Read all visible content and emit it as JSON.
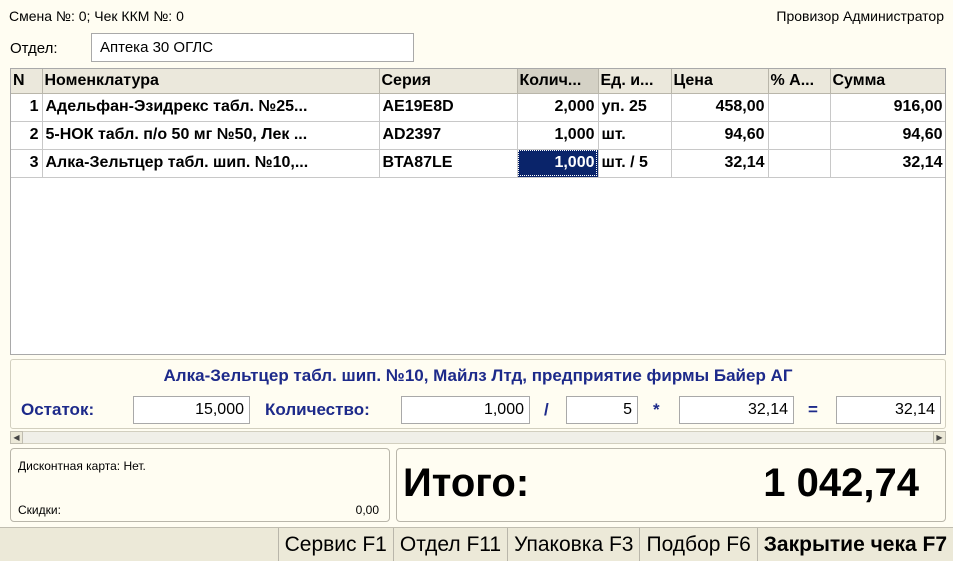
{
  "header": {
    "shift_info": "Смена №: 0; Чек ККМ №: 0",
    "user": "Провизор Администратор"
  },
  "department": {
    "label": "Отдел:",
    "value": "Аптека 30 ОГЛС"
  },
  "grid": {
    "columns": [
      "N",
      "Номенклатура",
      "Серия",
      "Колич...",
      "Ед. и...",
      "Цена",
      "% А...",
      "Сумма"
    ],
    "rows": [
      [
        "1",
        "Адельфан-Эзидрекс табл. №25...",
        "AE19E8D",
        "2,000",
        "уп. 25",
        "458,00",
        "",
        "916,00"
      ],
      [
        "2",
        "5-НОК табл. п/о 50 мг №50, Лек ...",
        "AD2397",
        "1,000",
        "шт.",
        "94,60",
        "",
        "94,60"
      ],
      [
        "3",
        "Алка-Зельтцер табл. шип. №10,...",
        "BTA87LE",
        "1,000",
        "шт. / 5",
        "32,14",
        "",
        "32,14"
      ]
    ]
  },
  "info": {
    "product_name": "Алка-Зельтцер табл. шип. №10, Майлз Лтд, предприятие фирмы Байер АГ",
    "stock_label": "Остаток:",
    "stock_value": "15,000",
    "qty_label": "Количество:",
    "qty_value": "1,000",
    "div_sign": "/",
    "pack_value": "5",
    "mul_sign": "*",
    "price_value": "32,14",
    "eq_sign": "=",
    "sum_value": "32,14"
  },
  "discount": {
    "card": "Дисконтная карта: Нет.",
    "label": "Скидки:",
    "value": "0,00"
  },
  "total": {
    "label": "Итого:",
    "value": "1 042,74"
  },
  "toolbar": {
    "service": "Сервис F1",
    "department": "Отдел F11",
    "package": "Упаковка F3",
    "selection": "Подбор F6",
    "close_check": "Закрытие чека F7"
  },
  "colors": {
    "accent_text": "#1d2a8a",
    "selection": "#0a246a",
    "background": "#fffdf2"
  }
}
